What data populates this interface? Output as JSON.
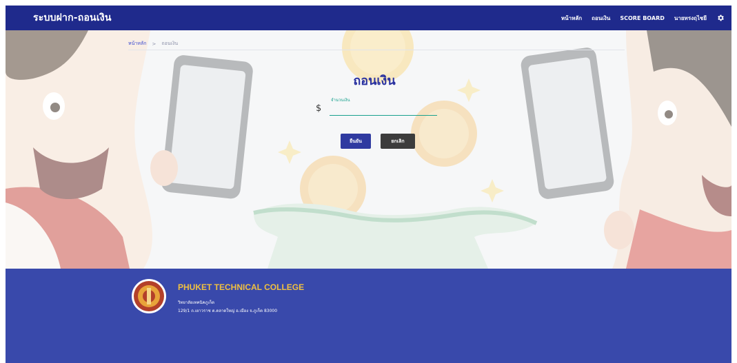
{
  "navbar": {
    "brand": "ระบบฝาก-ถอนเงิน",
    "links": [
      "หน้าหลัก",
      "ถอนเงิน",
      "SCORE BOARD",
      "นายทรงฤไชยี"
    ],
    "settings_icon": "gear-icon"
  },
  "breadcrumb": {
    "home": "หน้าหลัก",
    "separator": ">",
    "current": "ถอนเงิน"
  },
  "form": {
    "title": "ถอนเงิน",
    "currency_symbol": "$",
    "amount_label": "จำนวนเงิน",
    "amount_value": "",
    "confirm_label": "ยืนยัน",
    "cancel_label": "ยกเลิก"
  },
  "footer": {
    "college_name": "PHUKET TECHNICAL COLLEGE",
    "address_line1": "วิทยาลัยเทคนิคภูเก็ต",
    "address_line2": "129/1 ถ.เยาวราช ต.ตลาดใหญ่ อ.เมือง จ.ภูเก็ต 83000"
  },
  "colors": {
    "navbar": "#1f2a8c",
    "footer": "#3949ab",
    "accent": "#2f3aa0",
    "college_gold": "#f0c040"
  }
}
